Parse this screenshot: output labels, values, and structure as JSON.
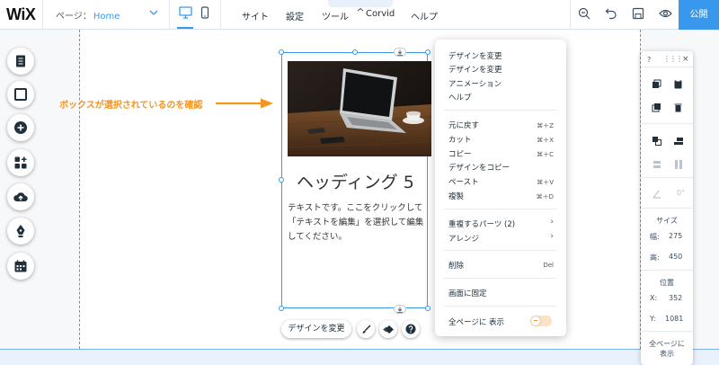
{
  "topbar": {
    "logo": "WiX",
    "page_label": "ページ：",
    "page_value": "Home",
    "menu": [
      "サイト",
      "設定",
      "ツール",
      "Corvid",
      "ヘルプ"
    ],
    "publish": "公開",
    "icons": [
      "desktop-icon",
      "mobile-icon",
      "zoom-out-icon",
      "undo-icon",
      "save-icon",
      "preview-eye-icon"
    ]
  },
  "left_toolbar": {
    "icons": [
      "pages-icon",
      "background-icon",
      "add-icon",
      "app-market-icon",
      "upload-icon",
      "blog-pen-icon",
      "bookings-icon"
    ]
  },
  "annotation": {
    "text": "ボックスが選択されているのを確認",
    "color": "#f7941d"
  },
  "selected_box": {
    "heading": "ヘッディング 5",
    "body": "テキストです。ここをクリックして「テキストを編集」を選択して編集してください。"
  },
  "action_bar": {
    "design_button": "デザインを変更"
  },
  "context_menu": {
    "items": [
      {
        "label": "デザインを変更",
        "shortcut": ""
      },
      {
        "label": "デザインを変更",
        "shortcut": ""
      },
      {
        "label": "アニメーション",
        "shortcut": ""
      },
      {
        "label": "ヘルプ",
        "shortcut": ""
      },
      {
        "label": "元に戻す",
        "shortcut": "⌘＋Z"
      },
      {
        "label": "カット",
        "shortcut": "⌘＋X"
      },
      {
        "label": "コピー",
        "shortcut": "⌘＋C"
      },
      {
        "label": "デザインをコピー",
        "shortcut": ""
      },
      {
        "label": "ペースト",
        "shortcut": "⌘＋V"
      },
      {
        "label": "複製",
        "shortcut": "⌘＋D"
      },
      {
        "label": "重複するパーツ (2)",
        "shortcut": "›"
      },
      {
        "label": "アレンジ",
        "shortcut": "›"
      },
      {
        "label": "削除",
        "shortcut": "Del"
      },
      {
        "label": "画面に固定",
        "shortcut": ""
      },
      {
        "label": "全ページに 表示",
        "shortcut": ""
      }
    ]
  },
  "right_panel": {
    "help": "?",
    "close": "×",
    "rotation": "0°",
    "size_label": "サイズ",
    "width_label": "幅:",
    "width_value": "275",
    "height_label": "高:",
    "height_value": "450",
    "position_label": "位置",
    "x_label": "X:",
    "x_value": "352",
    "y_label": "Y:",
    "y_value": "1081",
    "show_all_pages_line1": "全ページに",
    "show_all_pages_line2": "表示"
  },
  "colors": {
    "accent": "#3899ec",
    "annotation": "#f7941d"
  }
}
